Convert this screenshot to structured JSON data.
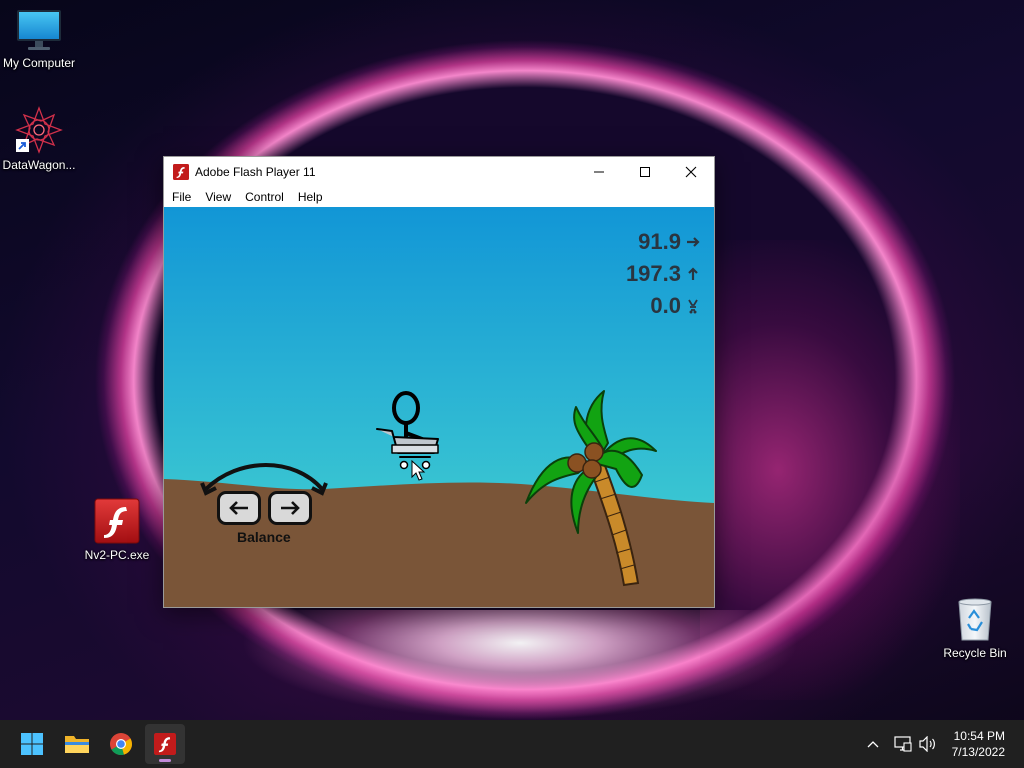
{
  "desktop": {
    "icons": [
      {
        "label": "My Computer",
        "icon": "monitor-icon"
      },
      {
        "label": "DataWagon...",
        "icon": "datawagon-shortcut-icon"
      },
      {
        "label": "Nv2-PC.exe",
        "icon": "flash-exe-icon"
      },
      {
        "label": "Recycle Bin",
        "icon": "recycle-bin-icon"
      }
    ]
  },
  "window": {
    "title": "Adobe Flash Player 11",
    "menu": [
      "File",
      "View",
      "Control",
      "Help"
    ],
    "controls": {
      "minimize": "minimize-icon",
      "maximize": "maximize-icon",
      "close": "close-icon"
    }
  },
  "game": {
    "hud": {
      "speed_x": "91.9",
      "speed_y": "197.3",
      "third_value": "0.0"
    },
    "balance_label": "Balance",
    "colors": {
      "sky_top": "#1296d6",
      "sky_bottom": "#33c3d4",
      "sand": "#7a5538",
      "palm_leaf": "#12a312",
      "trunk": "#c98a2a"
    }
  },
  "taskbar": {
    "apps": [
      "start-icon",
      "file-explorer-icon",
      "chrome-icon",
      "flash-player-icon"
    ],
    "active_app": "flash-player-icon",
    "tray": [
      "show-hidden-icons-chevron",
      "network-icon",
      "volume-icon"
    ],
    "time": "10:54 PM",
    "date": "7/13/2022"
  }
}
